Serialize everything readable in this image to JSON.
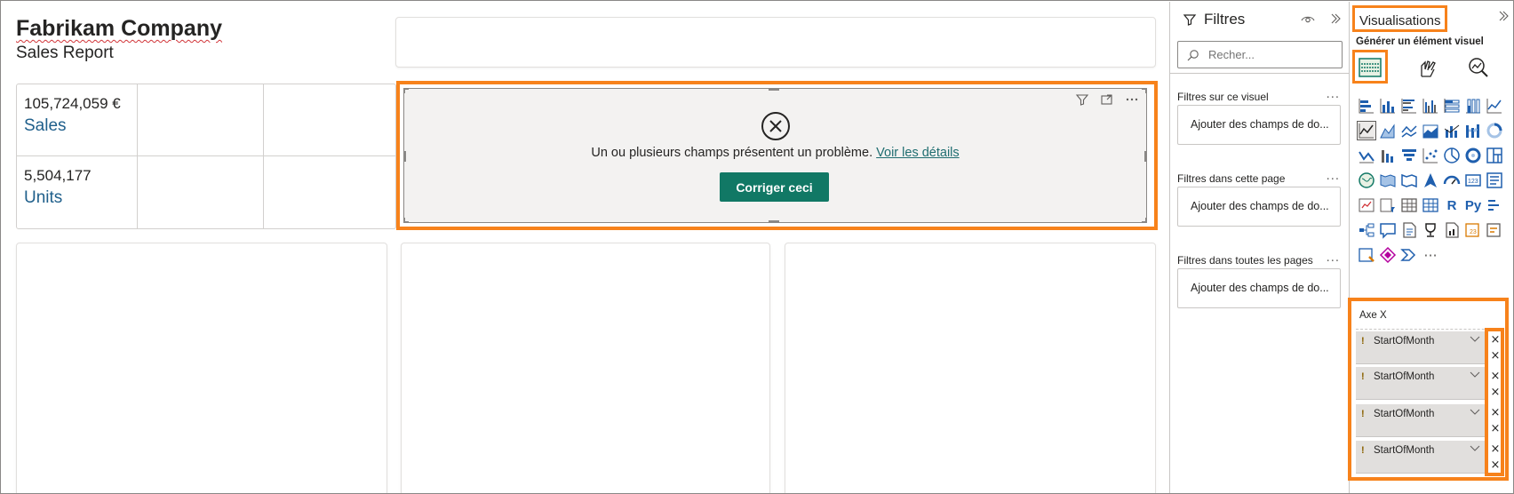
{
  "report": {
    "company_name": "Fabrikam Company",
    "subtitle": "Sales Report"
  },
  "kpis": [
    {
      "value": "105,724,059 €",
      "label": "Sales"
    },
    {
      "value": "5,504,177",
      "label": "Units"
    }
  ],
  "error_visual": {
    "message": "Un ou plusieurs champs présentent un problème.",
    "link": "Voir les détails",
    "fix_button": "Corriger ceci",
    "tool_icons": [
      "filter-icon",
      "focus-mode-icon",
      "more-options-icon"
    ]
  },
  "filters_pane": {
    "title": "Filtres",
    "search_placeholder": "Recher...",
    "sections": [
      {
        "title": "Filtres sur ce visuel",
        "well": "Ajouter des champs de do..."
      },
      {
        "title": "Filtres dans cette page",
        "well": "Ajouter des champs de do..."
      },
      {
        "title": "Filtres dans toutes les pages",
        "well": "Ajouter des champs de do..."
      }
    ],
    "more_label": "..."
  },
  "viz_pane": {
    "title": "Visualisations",
    "build_label": "Générer un élément visuel",
    "axis_label": "Axe X",
    "fields": [
      "StartOfMonth",
      "StartOfMonth",
      "StartOfMonth",
      "StartOfMonth"
    ],
    "warn_glyph": "!",
    "remove_glyph": "×",
    "more_visuals": "···",
    "text_icons": {
      "r": "R",
      "py": "Py"
    }
  },
  "colors": {
    "accent_orange": "#f7821b",
    "fix_button": "#117865",
    "link": "#1f6d70",
    "kpi_label": "#1f5f8b",
    "visual_icon_blue": "#1f5fae"
  }
}
